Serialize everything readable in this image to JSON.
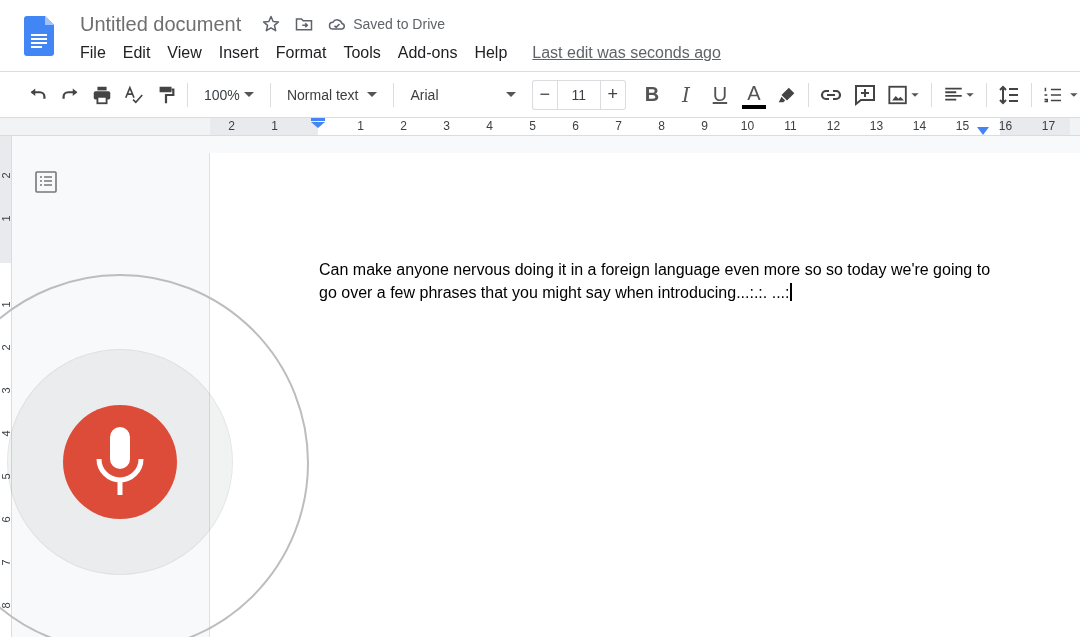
{
  "header": {
    "title": "Untitled document",
    "save_status": "Saved to Drive"
  },
  "menu": [
    "File",
    "Edit",
    "View",
    "Insert",
    "Format",
    "Tools",
    "Add-ons",
    "Help"
  ],
  "last_edit": "Last edit was seconds ago",
  "toolbar": {
    "zoom": "100%",
    "style": "Normal text",
    "font": "Arial",
    "size_minus": "−",
    "font_size": "11",
    "size_plus": "+",
    "format": [
      {
        "kind": "bold",
        "label": "B"
      },
      {
        "kind": "italic",
        "label": "I"
      },
      {
        "kind": "underline",
        "label": "U"
      },
      {
        "kind": "color",
        "label": "A"
      }
    ]
  },
  "ruler": {
    "left_numbers": [
      "2",
      "1"
    ],
    "numbers": [
      "1",
      "2",
      "3",
      "4",
      "5",
      "6",
      "7",
      "8",
      "9",
      "10",
      "11",
      "12",
      "13",
      "14",
      "15",
      "16",
      "17"
    ]
  },
  "vertical_ruler": {
    "top_numbers": [
      "2",
      "1"
    ],
    "numbers": [
      "1",
      "2",
      "3",
      "4",
      "5",
      "6",
      "7",
      "8"
    ]
  },
  "document": {
    "paragraphs": [
      "Can make anyone nervous doing it in a foreign language even more so so today we're going to go over a few phrases that you might say when introducing...:.:. ...:"
    ]
  },
  "voice_typing": {
    "listening": true
  }
}
